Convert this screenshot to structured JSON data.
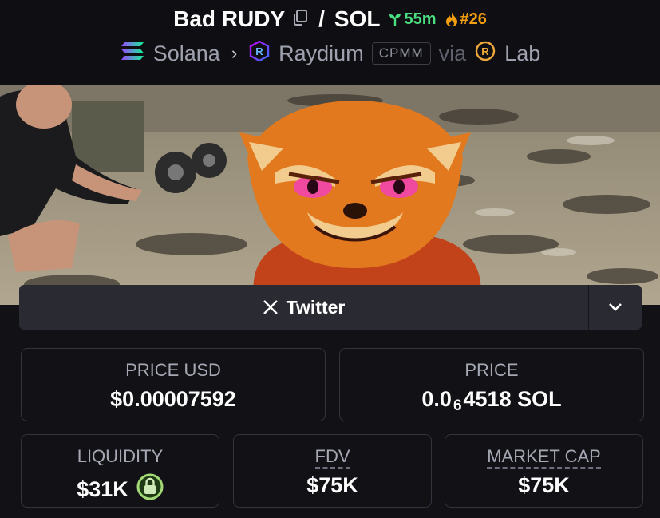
{
  "header": {
    "token_name": "Bad RUDY",
    "quote": "SOL",
    "age": "55m",
    "rank": "#26",
    "chain": "Solana",
    "dex": "Raydium",
    "pool_type": "CPMM",
    "via": "via",
    "launchpad": "Lab"
  },
  "links": {
    "twitter_label": "Twitter"
  },
  "stats": {
    "price_usd_label": "PRICE USD",
    "price_usd_value": "$0.00007592",
    "price_label": "PRICE",
    "price_prefix": "0.0",
    "price_zeros": "6",
    "price_suffix": "4518 SOL",
    "liquidity_label": "LIQUIDITY",
    "liquidity_value": "$31K",
    "fdv_label": "FDV",
    "fdv_value": "$75K",
    "mcap_label": "MARKET CAP",
    "mcap_value": "$75K"
  },
  "colors": {
    "age_green": "#4ade80",
    "rank_orange": "#f59e0b",
    "lock_green": "#a3d977"
  }
}
